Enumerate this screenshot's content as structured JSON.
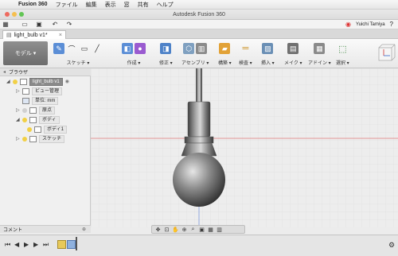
{
  "menubar": {
    "app": "Fusion 360",
    "items": [
      "ファイル",
      "編集",
      "表示",
      "窓",
      "共有",
      "ヘルプ"
    ]
  },
  "window": {
    "title": "Autodesk Fusion 360"
  },
  "user": {
    "name": "Yuichi Tamiya"
  },
  "document": {
    "tab_title": "light_bulb v1*"
  },
  "ribbon": {
    "workspace": "モデル ▾",
    "groups": [
      "スケッチ ▾",
      "作成 ▾",
      "修正 ▾",
      "アセンブリ ▾",
      "構築 ▾",
      "検査 ▾",
      "挿入 ▾",
      "メイク ▾",
      "アドイン ▾",
      "選択 ▾"
    ]
  },
  "browser": {
    "title": "ブラウザ",
    "nodes": [
      "light_bulb v1",
      "ビュー管理",
      "単位: mm",
      "原点",
      "ボディ",
      "ボディ1",
      "スケッチ"
    ]
  },
  "comments": {
    "title": "コメント"
  },
  "colors": {
    "workspace": "#7a7a7a",
    "axis_red": "#d9534f",
    "axis_blue": "#4a6fd0"
  },
  "icons": [
    "apple-icon",
    "grid-icon",
    "folder-icon",
    "save-icon",
    "undo-icon",
    "redo-icon",
    "record-icon",
    "help-icon",
    "play-icon",
    "gear-icon"
  ]
}
